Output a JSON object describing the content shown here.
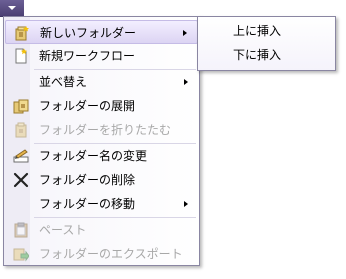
{
  "menu": {
    "items": [
      {
        "label": "新しいフォルダー",
        "icon": "new-folder-icon",
        "submenu": true,
        "highlighted": true,
        "enabled": true
      },
      {
        "label": "新規ワークフロー",
        "icon": "new-workflow-icon",
        "submenu": false,
        "enabled": true
      },
      {
        "label": "並べ替え",
        "icon": "",
        "submenu": true,
        "enabled": true
      },
      {
        "label": "フォルダーの展開",
        "icon": "expand-folder-icon",
        "submenu": false,
        "enabled": true
      },
      {
        "label": "フォルダーを折りたたむ",
        "icon": "collapse-folder-icon",
        "submenu": false,
        "enabled": false
      },
      {
        "label": "フォルダー名の変更",
        "icon": "rename-icon",
        "submenu": false,
        "enabled": true
      },
      {
        "label": "フォルダーの削除",
        "icon": "delete-x-icon",
        "submenu": false,
        "enabled": true
      },
      {
        "label": "フォルダーの移動",
        "icon": "",
        "submenu": true,
        "enabled": true
      },
      {
        "label": "ペースト",
        "icon": "paste-icon",
        "submenu": false,
        "enabled": false
      },
      {
        "label": "フォルダーのエクスポート",
        "icon": "export-folder-icon",
        "submenu": false,
        "enabled": false
      }
    ]
  },
  "submenu": {
    "items": [
      {
        "label": "上に挿入"
      },
      {
        "label": "下に挿入"
      }
    ]
  },
  "colors": {
    "highlight": "#dcd4f3",
    "trigger": "#584b84",
    "disabled_text": "#a8a8a8"
  }
}
